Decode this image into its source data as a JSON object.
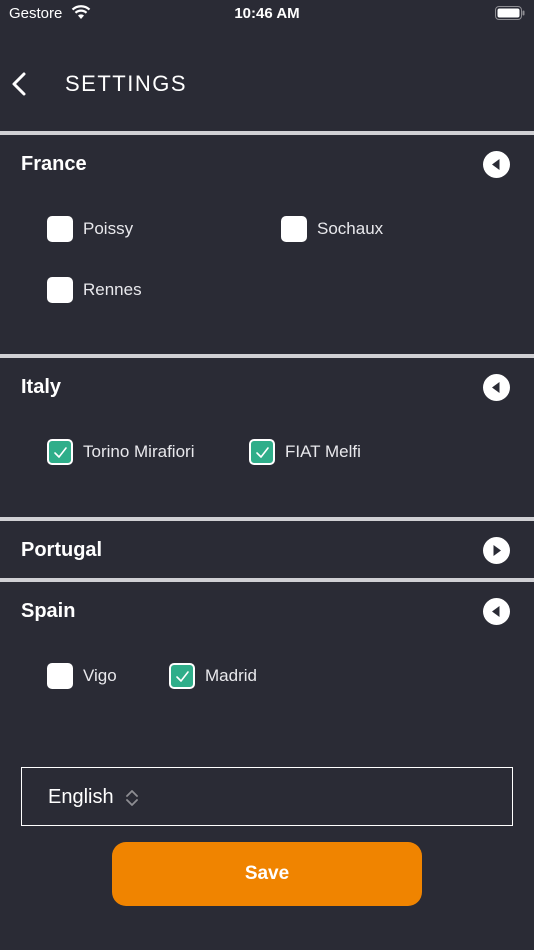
{
  "status_bar": {
    "carrier": "Gestore",
    "time": "10:46 AM"
  },
  "header": {
    "title": "SETTINGS",
    "back_icon": "chevron-left-icon"
  },
  "sections": [
    {
      "name": "France",
      "expanded": true,
      "items": [
        {
          "label": "Poissy",
          "checked": false
        },
        {
          "label": "Sochaux",
          "checked": false
        },
        {
          "label": "Rennes",
          "checked": false
        }
      ]
    },
    {
      "name": "Italy",
      "expanded": true,
      "items": [
        {
          "label": "Torino Mirafiori",
          "checked": true
        },
        {
          "label": "FIAT Melfi",
          "checked": true
        }
      ]
    },
    {
      "name": "Portugal",
      "expanded": false,
      "items": []
    },
    {
      "name": "Spain",
      "expanded": true,
      "items": [
        {
          "label": "Vigo",
          "checked": false
        },
        {
          "label": "Madrid",
          "checked": true
        }
      ]
    }
  ],
  "language": {
    "selected": "English"
  },
  "save_label": "Save",
  "colors": {
    "background": "#2a2b35",
    "accent": "#f08400",
    "checked": "#2fae8a"
  }
}
